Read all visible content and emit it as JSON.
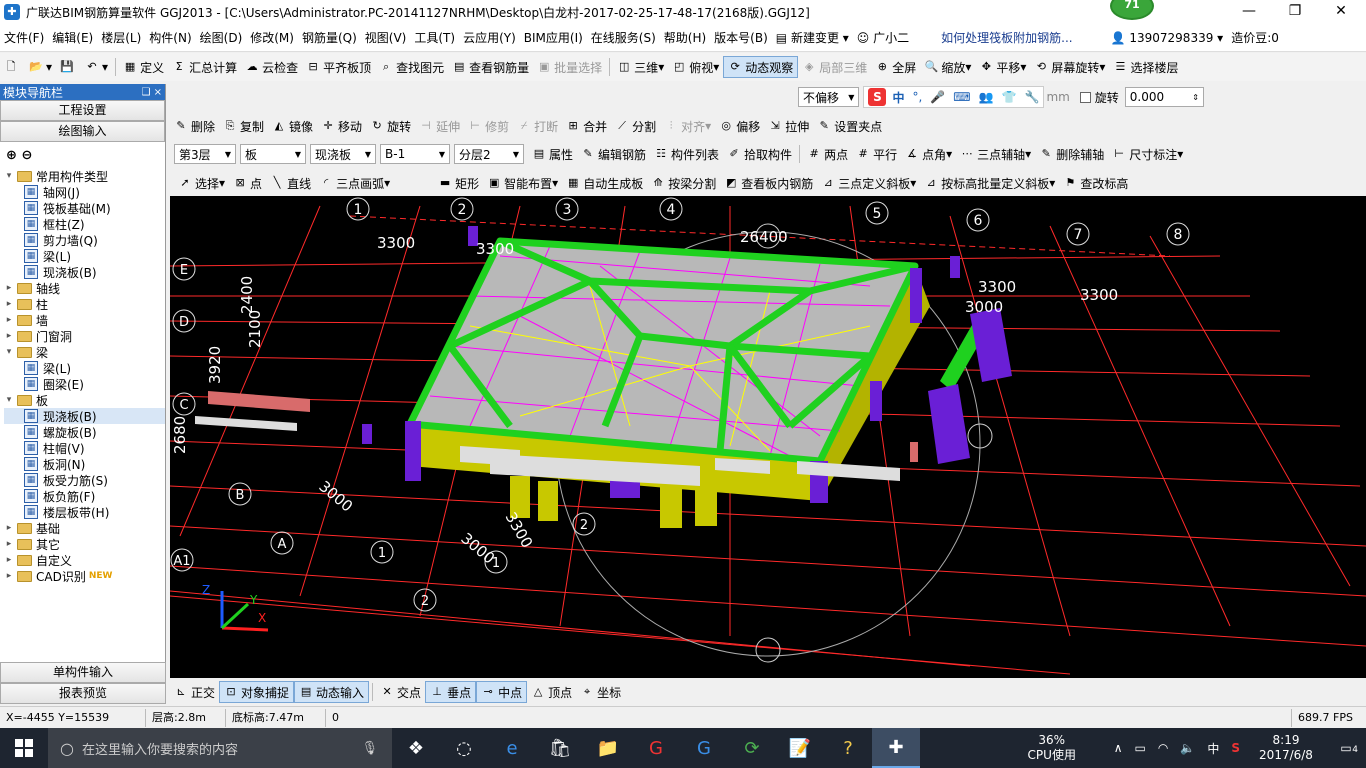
{
  "window": {
    "title": "广联达BIM钢筋算量软件 GGJ2013 - [C:\\Users\\Administrator.PC-20141127NRHM\\Desktop\\白龙村-2017-02-25-17-48-17(2168版).GGJ12]",
    "badge": "71",
    "minimize": "—",
    "restore": "❐",
    "close": "✕"
  },
  "menu": {
    "items": [
      "文件(F)",
      "编辑(E)",
      "楼层(L)",
      "构件(N)",
      "绘图(D)",
      "修改(M)",
      "钢筋量(Q)",
      "视图(V)",
      "工具(T)",
      "云应用(Y)",
      "BIM应用(I)",
      "在线服务(S)",
      "帮助(H)",
      "版本号(B)"
    ],
    "new_change": "新建变更",
    "guang_xiao_er": "广小二",
    "question": "如何处理筏板附加钢筋...",
    "phone": "13907298339",
    "zaojiadou": "造价豆:0"
  },
  "toolbar1": {
    "define": "定义",
    "sum_calc": "汇总计算",
    "cloud_check": "云检查",
    "align_top": "平齐板顶",
    "find_elem": "查找图元",
    "view_rebar": "查看钢筋量",
    "batch_select": "批量选择",
    "view3d": "三维",
    "top_view": "俯视",
    "dynamic_view": "动态观察",
    "local_3d": "局部三维",
    "full_screen": "全屏",
    "zoom": "缩放",
    "pan": "平移",
    "screen_rotate": "屏幕旋转",
    "select_floor": "选择楼层"
  },
  "toolbar_offset": {
    "offset_select": "不偏移",
    "unit": "mm",
    "rotate_label": "旋转",
    "rotate_value": "0.000",
    "ime_label": "中"
  },
  "toolbar2": {
    "delete": "删除",
    "copy": "复制",
    "mirror": "镜像",
    "move": "移动",
    "rotate": "旋转",
    "extend": "延伸",
    "trim": "修剪",
    "break": "打断",
    "merge": "合并",
    "split": "分割",
    "align": "对齐",
    "offset": "偏移",
    "stretch": "拉伸",
    "set_grip": "设置夹点"
  },
  "toolbar3": {
    "floor": "第3层",
    "category": "板",
    "type": "现浇板",
    "name": "B-1",
    "layer": "分层2",
    "property": "属性",
    "edit_rebar": "编辑钢筋",
    "comp_list": "构件列表",
    "pick_comp": "拾取构件",
    "two_point": "两点",
    "parallel": "平行",
    "point_angle": "点角",
    "three_point_axis": "三点辅轴",
    "delete_axis": "删除辅轴",
    "dim": "尺寸标注"
  },
  "toolbar4": {
    "select": "选择",
    "point": "点",
    "line": "直线",
    "arc3": "三点画弧",
    "rect": "矩形",
    "smart_place": "智能布置",
    "auto_gen": "自动生成板",
    "split_by_beam": "按梁分割",
    "view_slab_rebar": "查看板内钢筋",
    "slope3": "三点定义斜板",
    "slope_batch": "按标高批量定义斜板",
    "check_elev": "查改标高"
  },
  "left_panel": {
    "title": "模块导航栏",
    "pin": "❑ ×",
    "project_settings": "工程设置",
    "drawing_input": "绘图输入",
    "tree": [
      {
        "level": 0,
        "exp": "▾",
        "icon": "folder",
        "label": "常用构件类型"
      },
      {
        "level": 1,
        "icon": "comp",
        "label": "轴网(J)"
      },
      {
        "level": 1,
        "icon": "comp",
        "label": "筏板基础(M)"
      },
      {
        "level": 1,
        "icon": "comp",
        "label": "框柱(Z)"
      },
      {
        "level": 1,
        "icon": "comp",
        "label": "剪力墙(Q)"
      },
      {
        "level": 1,
        "icon": "comp",
        "label": "梁(L)"
      },
      {
        "level": 1,
        "icon": "comp",
        "label": "现浇板(B)"
      },
      {
        "level": 0,
        "exp": "▸",
        "icon": "folder",
        "label": "轴线"
      },
      {
        "level": 0,
        "exp": "▸",
        "icon": "folder",
        "label": "柱"
      },
      {
        "level": 0,
        "exp": "▸",
        "icon": "folder",
        "label": "墙"
      },
      {
        "level": 0,
        "exp": "▸",
        "icon": "folder",
        "label": "门窗洞"
      },
      {
        "level": 0,
        "exp": "▾",
        "icon": "folder",
        "label": "梁"
      },
      {
        "level": 1,
        "icon": "comp",
        "label": "梁(L)"
      },
      {
        "level": 1,
        "icon": "comp",
        "label": "圈梁(E)"
      },
      {
        "level": 0,
        "exp": "▾",
        "icon": "folder",
        "label": "板"
      },
      {
        "level": 1,
        "icon": "comp",
        "label": "现浇板(B)",
        "selected": true
      },
      {
        "level": 1,
        "icon": "comp",
        "label": "螺旋板(B)"
      },
      {
        "level": 1,
        "icon": "comp",
        "label": "柱帽(V)"
      },
      {
        "level": 1,
        "icon": "comp",
        "label": "板洞(N)"
      },
      {
        "level": 1,
        "icon": "comp",
        "label": "板受力筋(S)"
      },
      {
        "level": 1,
        "icon": "comp",
        "label": "板负筋(F)"
      },
      {
        "level": 1,
        "icon": "comp",
        "label": "楼层板带(H)"
      },
      {
        "level": 0,
        "exp": "▸",
        "icon": "folder",
        "label": "基础"
      },
      {
        "level": 0,
        "exp": "▸",
        "icon": "folder",
        "label": "其它"
      },
      {
        "level": 0,
        "exp": "▸",
        "icon": "folder",
        "label": "自定义"
      },
      {
        "level": 0,
        "exp": "▸",
        "icon": "folder",
        "label": "CAD识别",
        "new": "NEW"
      }
    ],
    "single_input": "单构件输入",
    "report_preview": "报表预览"
  },
  "viewport": {
    "axis_numbers": [
      "1",
      "2",
      "3",
      "4",
      "5",
      "6",
      "7",
      "8"
    ],
    "axis_letters": [
      "E",
      "D",
      "C",
      "B",
      "A1"
    ],
    "dims": [
      "3300",
      "3300",
      "26400",
      "3300",
      "3000",
      "3300",
      "2400",
      "2100",
      "3920",
      "2680",
      "3000",
      "3000",
      "3300"
    ],
    "front_numbers": [
      "A",
      "1",
      "2",
      "1",
      "2"
    ],
    "triad": {
      "x": "X",
      "y": "Y",
      "z": "Z"
    }
  },
  "snapbar": {
    "ortho": "正交",
    "obj_snap": "对象捕捉",
    "dyn_input": "动态输入",
    "intersection": "交点",
    "perpendicular": "垂点",
    "midpoint": "中点",
    "vertex": "顶点",
    "coordinate": "坐标"
  },
  "statusbar": {
    "coords": "X=-4455 Y=15539",
    "floor_height": "层高:2.8m",
    "bottom_elev": "底标高:7.47m",
    "value": "0",
    "fps": "689.7 FPS"
  },
  "taskbar": {
    "search_placeholder": "在这里输入你要搜索的内容",
    "cpu_pct": "36%",
    "cpu_label": "CPU使用",
    "ime": "中",
    "time": "8:19",
    "date": "2017/6/8",
    "notif": "4"
  },
  "colors": {
    "slab_gray": "#b8b8b8",
    "beam_green": "#1fd11f",
    "column_purple": "#6a1fd6",
    "side_yellow": "#c8c800",
    "rebar_magenta": "#ff00ff",
    "rebar_yellow": "#ffff00",
    "grid_red": "#ff2a2a"
  }
}
